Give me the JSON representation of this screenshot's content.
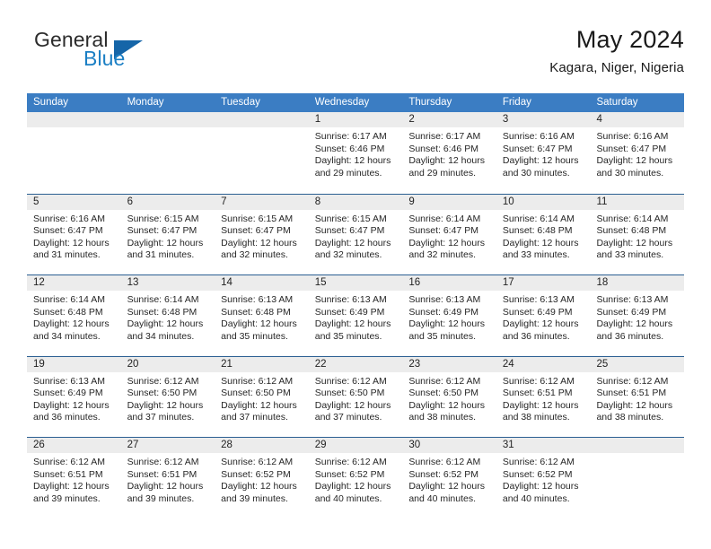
{
  "logo": {
    "word_top": "General",
    "word_bottom": "Blue",
    "icon": "blue-triangle",
    "accent_color": "#1b7fc4"
  },
  "header": {
    "title": "May 2024",
    "subtitle": "Kagara, Niger, Nigeria"
  },
  "colors": {
    "weekday_header_bg": "#3b7dc3",
    "weekday_header_text": "#ffffff",
    "day_number_bar": "#ececec",
    "row_separator": "#2b5f92"
  },
  "calendar": {
    "weekdays": [
      "Sunday",
      "Monday",
      "Tuesday",
      "Wednesday",
      "Thursday",
      "Friday",
      "Saturday"
    ],
    "weeks": [
      [
        {
          "day": "",
          "info": ""
        },
        {
          "day": "",
          "info": ""
        },
        {
          "day": "",
          "info": ""
        },
        {
          "day": "1",
          "info": "Sunrise: 6:17 AM\nSunset: 6:46 PM\nDaylight: 12 hours\nand 29 minutes."
        },
        {
          "day": "2",
          "info": "Sunrise: 6:17 AM\nSunset: 6:46 PM\nDaylight: 12 hours\nand 29 minutes."
        },
        {
          "day": "3",
          "info": "Sunrise: 6:16 AM\nSunset: 6:47 PM\nDaylight: 12 hours\nand 30 minutes."
        },
        {
          "day": "4",
          "info": "Sunrise: 6:16 AM\nSunset: 6:47 PM\nDaylight: 12 hours\nand 30 minutes."
        }
      ],
      [
        {
          "day": "5",
          "info": "Sunrise: 6:16 AM\nSunset: 6:47 PM\nDaylight: 12 hours\nand 31 minutes."
        },
        {
          "day": "6",
          "info": "Sunrise: 6:15 AM\nSunset: 6:47 PM\nDaylight: 12 hours\nand 31 minutes."
        },
        {
          "day": "7",
          "info": "Sunrise: 6:15 AM\nSunset: 6:47 PM\nDaylight: 12 hours\nand 32 minutes."
        },
        {
          "day": "8",
          "info": "Sunrise: 6:15 AM\nSunset: 6:47 PM\nDaylight: 12 hours\nand 32 minutes."
        },
        {
          "day": "9",
          "info": "Sunrise: 6:14 AM\nSunset: 6:47 PM\nDaylight: 12 hours\nand 32 minutes."
        },
        {
          "day": "10",
          "info": "Sunrise: 6:14 AM\nSunset: 6:48 PM\nDaylight: 12 hours\nand 33 minutes."
        },
        {
          "day": "11",
          "info": "Sunrise: 6:14 AM\nSunset: 6:48 PM\nDaylight: 12 hours\nand 33 minutes."
        }
      ],
      [
        {
          "day": "12",
          "info": "Sunrise: 6:14 AM\nSunset: 6:48 PM\nDaylight: 12 hours\nand 34 minutes."
        },
        {
          "day": "13",
          "info": "Sunrise: 6:14 AM\nSunset: 6:48 PM\nDaylight: 12 hours\nand 34 minutes."
        },
        {
          "day": "14",
          "info": "Sunrise: 6:13 AM\nSunset: 6:48 PM\nDaylight: 12 hours\nand 35 minutes."
        },
        {
          "day": "15",
          "info": "Sunrise: 6:13 AM\nSunset: 6:49 PM\nDaylight: 12 hours\nand 35 minutes."
        },
        {
          "day": "16",
          "info": "Sunrise: 6:13 AM\nSunset: 6:49 PM\nDaylight: 12 hours\nand 35 minutes."
        },
        {
          "day": "17",
          "info": "Sunrise: 6:13 AM\nSunset: 6:49 PM\nDaylight: 12 hours\nand 36 minutes."
        },
        {
          "day": "18",
          "info": "Sunrise: 6:13 AM\nSunset: 6:49 PM\nDaylight: 12 hours\nand 36 minutes."
        }
      ],
      [
        {
          "day": "19",
          "info": "Sunrise: 6:13 AM\nSunset: 6:49 PM\nDaylight: 12 hours\nand 36 minutes."
        },
        {
          "day": "20",
          "info": "Sunrise: 6:12 AM\nSunset: 6:50 PM\nDaylight: 12 hours\nand 37 minutes."
        },
        {
          "day": "21",
          "info": "Sunrise: 6:12 AM\nSunset: 6:50 PM\nDaylight: 12 hours\nand 37 minutes."
        },
        {
          "day": "22",
          "info": "Sunrise: 6:12 AM\nSunset: 6:50 PM\nDaylight: 12 hours\nand 37 minutes."
        },
        {
          "day": "23",
          "info": "Sunrise: 6:12 AM\nSunset: 6:50 PM\nDaylight: 12 hours\nand 38 minutes."
        },
        {
          "day": "24",
          "info": "Sunrise: 6:12 AM\nSunset: 6:51 PM\nDaylight: 12 hours\nand 38 minutes."
        },
        {
          "day": "25",
          "info": "Sunrise: 6:12 AM\nSunset: 6:51 PM\nDaylight: 12 hours\nand 38 minutes."
        }
      ],
      [
        {
          "day": "26",
          "info": "Sunrise: 6:12 AM\nSunset: 6:51 PM\nDaylight: 12 hours\nand 39 minutes."
        },
        {
          "day": "27",
          "info": "Sunrise: 6:12 AM\nSunset: 6:51 PM\nDaylight: 12 hours\nand 39 minutes."
        },
        {
          "day": "28",
          "info": "Sunrise: 6:12 AM\nSunset: 6:52 PM\nDaylight: 12 hours\nand 39 minutes."
        },
        {
          "day": "29",
          "info": "Sunrise: 6:12 AM\nSunset: 6:52 PM\nDaylight: 12 hours\nand 40 minutes."
        },
        {
          "day": "30",
          "info": "Sunrise: 6:12 AM\nSunset: 6:52 PM\nDaylight: 12 hours\nand 40 minutes."
        },
        {
          "day": "31",
          "info": "Sunrise: 6:12 AM\nSunset: 6:52 PM\nDaylight: 12 hours\nand 40 minutes."
        },
        {
          "day": "",
          "info": ""
        }
      ]
    ]
  }
}
